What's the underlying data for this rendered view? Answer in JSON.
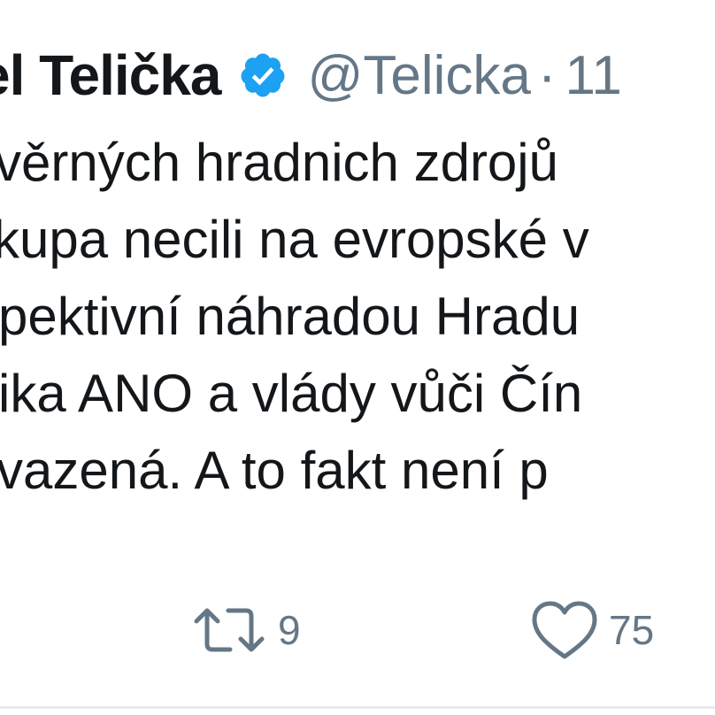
{
  "tweet": {
    "author_name": "el Telička",
    "handle": "@Telicka",
    "separator": "·",
    "time": "11",
    "verified_icon": "verified-badge-icon",
    "verified_color": "#1da1f2",
    "lines": [
      "věrných hradnich zdrojů",
      "kupa necili na evropské v",
      "pektivní náhradou Hradu",
      "ika ANO a vlády vůči Čín",
      "vazená. A to fakt není p"
    ],
    "retweet_icon": "retweet-icon",
    "retweet_count": "9",
    "like_icon": "heart-icon",
    "like_count": "75"
  }
}
